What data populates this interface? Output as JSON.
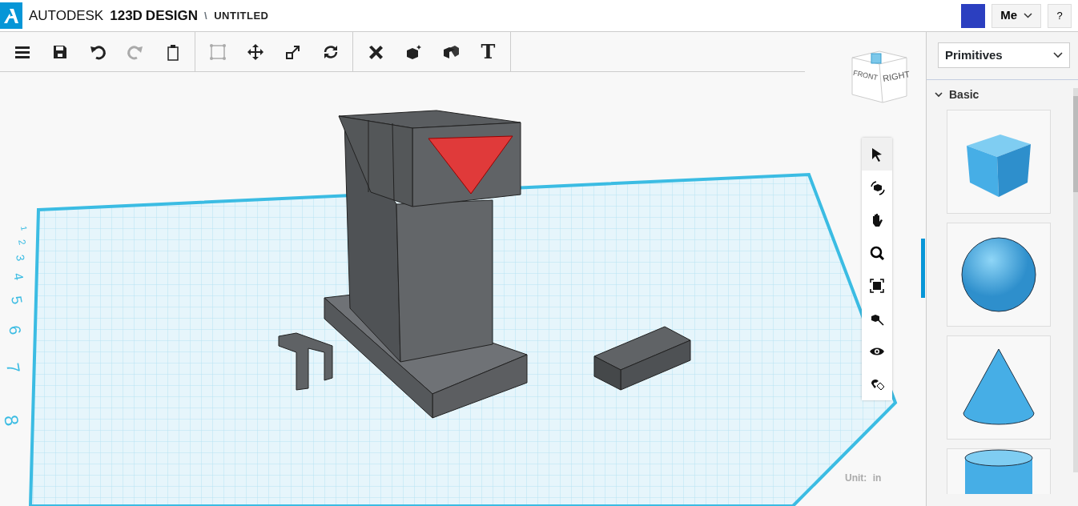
{
  "header": {
    "brand_light": "AUTODESK",
    "brand_bold": "123D",
    "brand_title": "DESIGN",
    "separator": "\\",
    "document": "UNTITLED",
    "user_menu": "Me",
    "help": "?"
  },
  "toolbar": {
    "groups": [
      [
        {
          "disabled": false
        },
        {
          "disabled": false
        },
        {
          "disabled": false
        },
        {
          "disabled": true
        },
        {
          "disabled": false
        }
      ],
      [
        {
          "disabled": true
        },
        {
          "disabled": false
        },
        {
          "disabled": false
        },
        {
          "disabled": false
        }
      ],
      [
        {
          "disabled": false
        },
        {
          "disabled": false
        },
        {
          "disabled": false
        },
        {
          "disabled": false,
          "glyph": "T"
        }
      ]
    ]
  },
  "view_cube": {
    "front": "FRONT",
    "right": "RIGHT"
  },
  "nav_tools": [
    {
      "selected": true
    },
    {
      "selected": false
    },
    {
      "selected": false
    },
    {
      "selected": false
    },
    {
      "selected": false
    },
    {
      "selected": false
    },
    {
      "selected": false
    },
    {
      "selected": false
    }
  ],
  "ruler_labels": [
    "1",
    "2",
    "3",
    "4",
    "5",
    "6",
    "7",
    "8"
  ],
  "unit": {
    "label": "Unit:",
    "value": "in"
  },
  "panel": {
    "dropdown": "Primitives",
    "section": {
      "title": "Basic",
      "expanded": true
    },
    "shapes": [
      {
        "kind": "cube"
      },
      {
        "kind": "sphere"
      },
      {
        "kind": "cone"
      },
      {
        "kind": "cylinder"
      }
    ]
  }
}
